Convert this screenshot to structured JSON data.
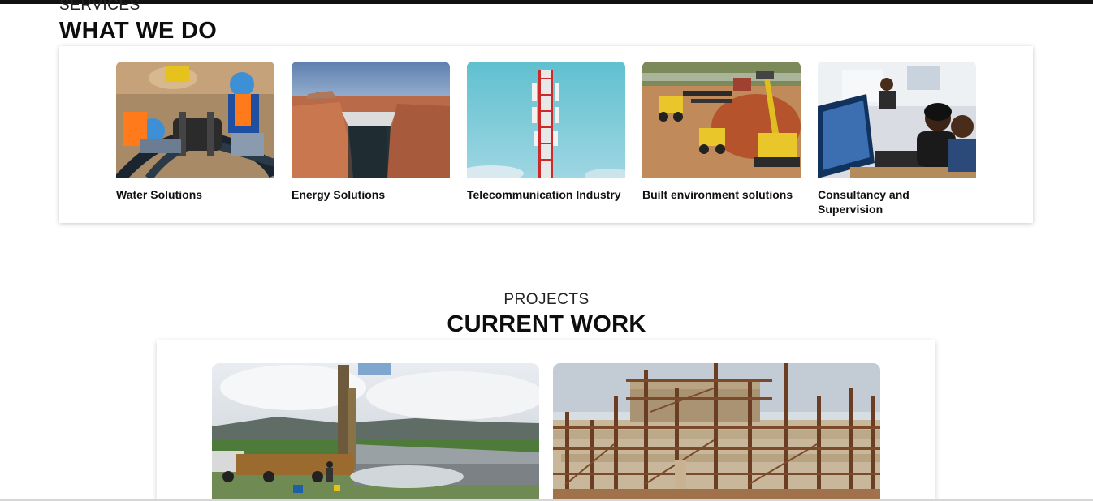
{
  "services": {
    "eyebrow": "SERVICES",
    "title": "WHAT WE DO",
    "items": [
      {
        "label": "Water Solutions",
        "image": "workers-fusing-water-pipes"
      },
      {
        "label": "Energy Solutions",
        "image": "hydroelectric-dam-canyon"
      },
      {
        "label": "Telecommunication Industry",
        "image": "telecom-tower-sky"
      },
      {
        "label": "Built environment solutions",
        "image": "construction-excavators-site"
      },
      {
        "label": "Consultancy and Supervision",
        "image": "consultants-at-computer"
      }
    ]
  },
  "projects": {
    "eyebrow": "PROJECTS",
    "title": "CURRENT WORK",
    "items": [
      {
        "image": "borehole-drilling-rig"
      },
      {
        "image": "building-under-construction-scaffolding"
      }
    ]
  },
  "colors": {
    "top_bar": "#111111",
    "heading": "#0d0d0d",
    "card_background": "#ffffff"
  }
}
